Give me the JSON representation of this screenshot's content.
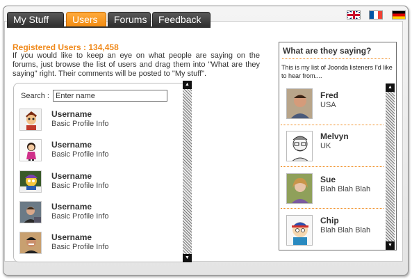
{
  "tabs": [
    {
      "label": "My Stuff",
      "active": false
    },
    {
      "label": "Users",
      "active": true
    },
    {
      "label": "Forums",
      "active": false
    },
    {
      "label": "Feedback",
      "active": false
    }
  ],
  "flags": [
    "uk-flag-icon",
    "france-flag-icon",
    "germany-flag-icon"
  ],
  "registered": "Registered Users : 134,458",
  "intro": "If you would like to keep an eye on what people are saying on the forums, just browse the list of users and drag them into \"What are they saying\" right. Their comments will be posted to \"My stuff\".",
  "search": {
    "label": "Search :",
    "value": "Enter name"
  },
  "users": [
    {
      "name": "Username",
      "info": "Basic Profile Info"
    },
    {
      "name": "Username",
      "info": "Basic Profile Info"
    },
    {
      "name": "Username",
      "info": "Basic Profile Info"
    },
    {
      "name": "Username",
      "info": "Basic Profile Info"
    },
    {
      "name": "Username",
      "info": "Basic Profile Info"
    }
  ],
  "saying": {
    "title": "What are they saying?",
    "desc": "This is my list of Joonda listeners I'd like to hear from....",
    "listeners": [
      {
        "name": "Fred",
        "sub": "USA"
      },
      {
        "name": "Melvyn",
        "sub": "UK"
      },
      {
        "name": "Sue",
        "sub": "Blah Blah Blah"
      },
      {
        "name": "Chip",
        "sub": "Blah Blah Blah"
      }
    ]
  },
  "colors": {
    "accent": "#f08a1c",
    "tab_dark": "#3a3a3a",
    "tab_active": "#f7941d"
  }
}
